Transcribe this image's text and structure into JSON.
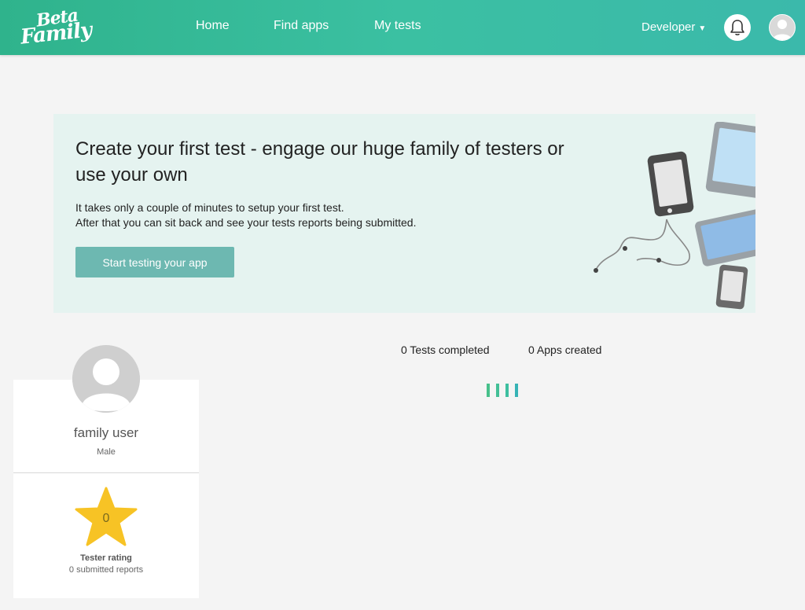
{
  "brand": {
    "logo_line1": "Beta",
    "logo_line2": "Family"
  },
  "nav": {
    "home": "Home",
    "find_apps": "Find apps",
    "my_tests": "My tests",
    "role": "Developer"
  },
  "icons": {
    "notifications": "bell-icon",
    "account": "user-avatar-icon",
    "dropdown": "caret-down-icon"
  },
  "banner": {
    "title": "Create your first test - engage our huge family of testers or use your own",
    "line1": "It takes only a couple of minutes to setup your first test.",
    "line2": "After that you can sit back and see your tests reports being submitted.",
    "cta": "Start testing your app"
  },
  "stats": {
    "tests_completed": "0 Tests completed",
    "apps_created": "0 Apps created"
  },
  "profile": {
    "name": "family user",
    "gender": "Male",
    "rating_value": "0",
    "rating_label": "Tester rating",
    "submitted_reports": "0 submitted reports"
  },
  "colors": {
    "header_start": "#2fb38c",
    "header_end": "#3bb9ab",
    "banner_bg": "#e5f3f0",
    "cta_bg": "#6db8b1",
    "star": "#f7c325",
    "loader": "#3dbfa0"
  }
}
